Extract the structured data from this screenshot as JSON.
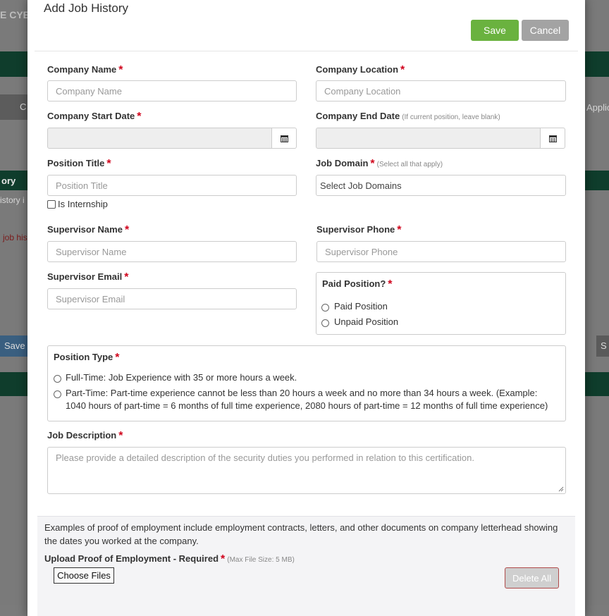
{
  "background": {
    "brand_fragment": "E CYB",
    "breadcrumb_fragment": "C",
    "applic_fragment": "Applic",
    "section_fragment": "ory",
    "history_fragment": "istory i",
    "job_fragment": "job his",
    "save_fragment": "Save",
    "right_btn_fragment": "S"
  },
  "modal": {
    "title": "Add Job History",
    "save_label": "Save",
    "cancel_label": "Cancel"
  },
  "fields": {
    "company_name": {
      "label": "Company Name",
      "placeholder": "Company Name"
    },
    "company_location": {
      "label": "Company Location",
      "placeholder": "Company Location"
    },
    "start_date": {
      "label": "Company Start Date"
    },
    "end_date": {
      "label": "Company End Date",
      "hint": "(If current position, leave blank)"
    },
    "position_title": {
      "label": "Position Title",
      "placeholder": "Position Title"
    },
    "is_internship_label": "Is Internship",
    "job_domain": {
      "label": "Job Domain",
      "hint": "(Select all that apply)",
      "placeholder": "Select Job Domains"
    },
    "supervisor_name": {
      "label": "Supervisor Name",
      "placeholder": "Supervisor Name"
    },
    "supervisor_phone": {
      "label": "Supervisor Phone",
      "placeholder": "Supervisor Phone"
    },
    "supervisor_email": {
      "label": "Supervisor Email",
      "placeholder": "Supervisor Email"
    },
    "paid_position": {
      "label": "Paid Position?",
      "options": [
        "Paid Position",
        "Unpaid Position"
      ]
    },
    "position_type": {
      "label": "Position Type",
      "options": [
        "Full-Time: Job Experience with 35 or more hours a week.",
        "Part-Time: Part-time experience cannot be less than 20 hours a week and no more than 34 hours a week. (Example: 1040 hours of part-time = 6 months of full time experience, 2080 hours of part-time = 12 months of full time experience)"
      ]
    },
    "job_description": {
      "label": "Job Description",
      "placeholder": "Please provide a detailed description of the security duties you performed in relation to this certification."
    }
  },
  "upload": {
    "info": "Examples of proof of employment include employment contracts, letters, and other documents on company letterhead showing the dates you worked at the company.",
    "label": "Upload Proof of Employment - Required",
    "hint": "(Max File Size: 5 MB)",
    "choose_label": "Choose Files",
    "delete_label": "Delete All"
  },
  "required_marker": "*",
  "colors": {
    "save": "#6ab23f",
    "cancel": "#a3a3a3",
    "required": "#d0021b",
    "brand_band": "#0f3d2c"
  }
}
